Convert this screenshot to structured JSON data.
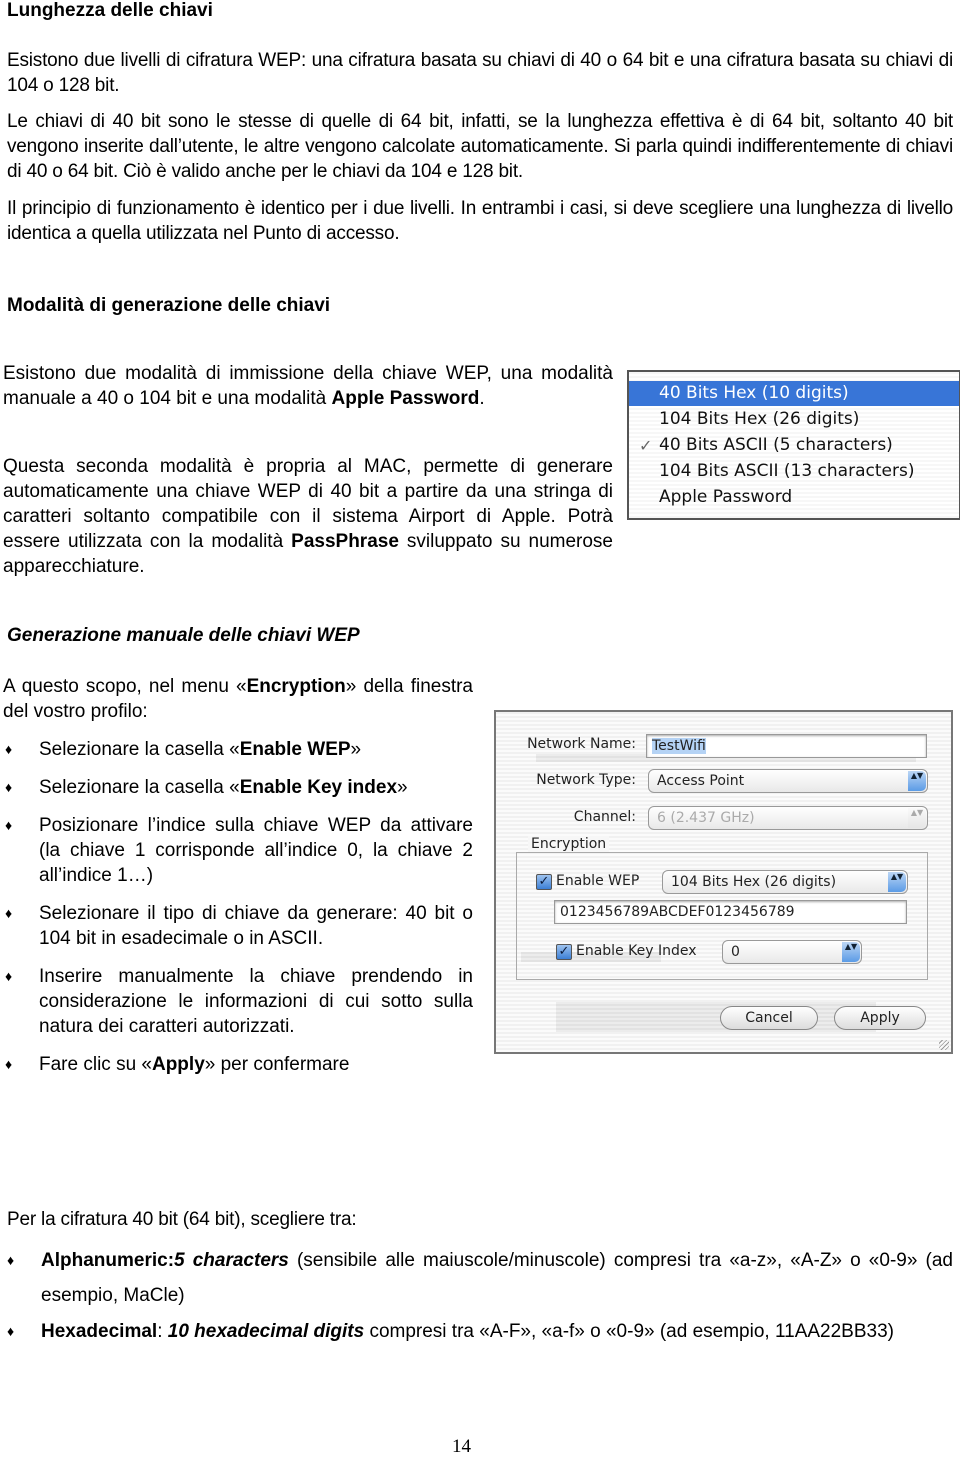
{
  "section1": {
    "title": "Lunghezza delle chiavi",
    "p1": "Esistono due livelli di cifratura WEP: una cifratura basata su chiavi di 40 o 64 bit e una cifratura basata su chiavi di 104 o 128 bit.",
    "p2": "Le chiavi di 40 bit sono le stesse di quelle di 64 bit, infatti, se la lunghezza effettiva è di 64 bit, soltanto 40 bit vengono inserite dall’utente, le altre vengono calcolate automaticamente. Si parla quindi indifferentemente di chiavi di 40 o 64 bit. Ciò è valido anche per le chiavi da 104 e 128 bit.",
    "p3": "Il principio di funzionamento è identico per i due livelli. In entrambi i casi, si deve scegliere una lunghezza di livello identica a quella utilizzata nel Punto di accesso."
  },
  "section2": {
    "title": "Modalità di generazione delle chiavi",
    "p1_a": "Esistono due modalità di immissione della chiave WEP, una modalità manuale a 40 o 104 bit e una modalità ",
    "p1_b": "Apple Password",
    "p1_c": ".",
    "p2_a": "Questa seconda modalità è propria al MAC, permette di generare automaticamente una chiave WEP di 40 bit a partire da una stringa di caratteri soltanto compatibile con il sistema Airport di Apple. Potrà essere utilizzata con la modalità ",
    "p2_b": "PassPhrase",
    "p2_c": " sviluppato su numerose apparecchiature."
  },
  "key_menu": {
    "items": [
      {
        "label": "40 Bits Hex (10 digits)",
        "highlighted": true,
        "checked": false
      },
      {
        "label": "104 Bits Hex (26 digits)",
        "highlighted": false,
        "checked": false
      },
      {
        "label": "40 Bits ASCII (5 characters)",
        "highlighted": false,
        "checked": true
      },
      {
        "label": "104 Bits ASCII (13 characters)",
        "highlighted": false,
        "checked": false
      },
      {
        "label": "Apple Password",
        "highlighted": false,
        "checked": false
      }
    ],
    "check_glyph": "✓"
  },
  "section3": {
    "title": "Generazione manuale delle chiavi WEP",
    "intro_a": "A questo scopo, nel menu «",
    "intro_b": "Encryption",
    "intro_c": "» della finestra del vostro profilo:",
    "bullets": [
      {
        "a": "Selezionare la casella «",
        "b": "Enable WEP",
        "c": "»"
      },
      {
        "a": "Selezionare la casella «",
        "b": "Enable Key index",
        "c": "»"
      },
      {
        "a": "Posizionare l’indice sulla chiave WEP da attivare (la chiave 1 corrisponde all’indice 0, la chiave 2 all’indice 1…)",
        "b": "",
        "c": ""
      },
      {
        "a": "Selezionare il tipo di chiave da generare: 40 bit o 104 bit in esadecimale o in ASCII.",
        "b": "",
        "c": ""
      },
      {
        "a": "Inserire manualmente la chiave prendendo in considerazione le informazioni di cui sotto sulla natura dei caratteri autorizzati.",
        "b": "",
        "c": ""
      },
      {
        "a": "Fare clic su «",
        "b": "Apply",
        "c": "» per confermare"
      }
    ],
    "bullet_glyph": "♦"
  },
  "dialog": {
    "network_name_label": "Network Name:",
    "network_name_value": "TestWifi",
    "network_type_label": "Network Type:",
    "network_type_value": "Access Point",
    "channel_label": "Channel:",
    "channel_value": "6 (2.437 GHz)",
    "encryption_label": "Encryption",
    "enable_wep_label": "Enable WEP",
    "enable_wep_checked": true,
    "key_type_value": "104 Bits Hex (26 digits)",
    "key_value": "0123456789ABCDEF0123456789",
    "enable_key_index_label": "Enable Key Index",
    "enable_key_index_checked": true,
    "key_index_value": "0",
    "cancel_label": "Cancel",
    "apply_label": "Apply",
    "checkmark": "✓",
    "stepper_glyph": "▲▼"
  },
  "section4": {
    "intro": "Per la cifratura 40 bit (64 bit), scegliere tra:",
    "b1_label": "Alphanumeric:",
    "b1_em": "5 characters",
    "b1_rest": " (sensibile alle maiuscole/minuscole) compresi tra «a-z», «A-Z» o «0-9» (ad esempio, MaCle)",
    "b2_label": "Hexadecimal",
    "b2_colon": ": ",
    "b2_em": "10 hexadecimal digits",
    "b2_rest": " compresi tra «A-F», «a-f» o «0-9» (ad esempio, 11AA22BB33)"
  },
  "page_number": "14"
}
